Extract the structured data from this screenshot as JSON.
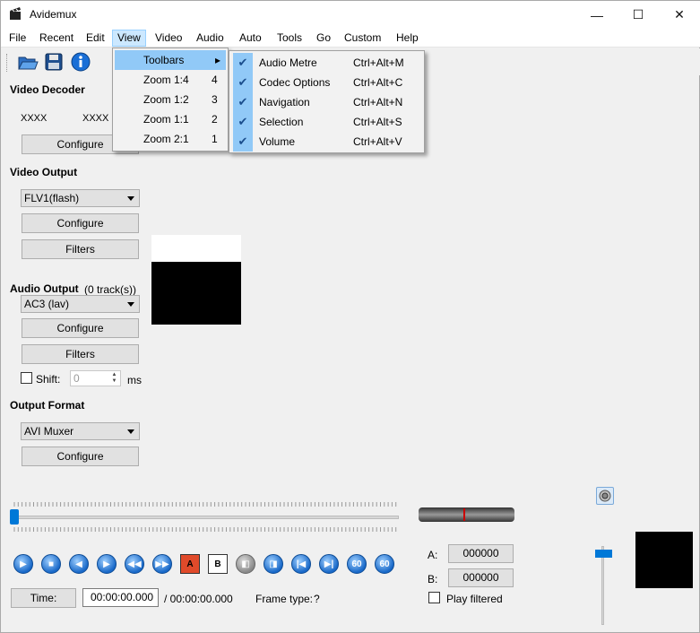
{
  "window": {
    "title": "Avidemux",
    "minimize_glyph": "—",
    "maximize_glyph": "☐",
    "close_glyph": "✕"
  },
  "menubar": {
    "items": [
      "File",
      "Recent",
      "Edit",
      "View",
      "Video",
      "Audio",
      "Auto",
      "Tools",
      "Go",
      "Custom",
      "Help"
    ],
    "open_menu": "View"
  },
  "toolbar": {
    "icons": [
      "open-file-icon",
      "save-file-icon",
      "info-icon"
    ]
  },
  "view_menu": {
    "items": [
      {
        "label": "Toolbars",
        "key": "▸",
        "highlighted": true
      },
      {
        "label": "Zoom 1:4",
        "key": "4"
      },
      {
        "label": "Zoom 1:2",
        "key": "3"
      },
      {
        "label": "Zoom 1:1",
        "key": "2"
      },
      {
        "label": "Zoom 2:1",
        "key": "1"
      }
    ]
  },
  "toolbars_submenu": {
    "items": [
      {
        "label": "Audio Metre",
        "shortcut": "Ctrl+Alt+M",
        "checked": true
      },
      {
        "label": "Codec Options",
        "shortcut": "Ctrl+Alt+C",
        "checked": true
      },
      {
        "label": "Navigation",
        "shortcut": "Ctrl+Alt+N",
        "checked": true
      },
      {
        "label": "Selection",
        "shortcut": "Ctrl+Alt+S",
        "checked": true
      },
      {
        "label": "Volume",
        "shortcut": "Ctrl+Alt+V",
        "checked": true
      }
    ],
    "check_glyph": "✔"
  },
  "video_decoder": {
    "title": "Video Decoder",
    "value_left": "XXXX",
    "value_right": "XXXX",
    "configure_label": "Configure"
  },
  "video_output": {
    "title": "Video Output",
    "codec": "FLV1(flash)",
    "configure_label": "Configure",
    "filters_label": "Filters"
  },
  "audio_output": {
    "title": "Audio Output",
    "tracks": "(0 track(s))",
    "codec": "AC3 (lav)",
    "configure_label": "Configure",
    "filters_label": "Filters",
    "shift_label": "Shift:",
    "shift_value": "0",
    "shift_unit": "ms"
  },
  "output_format": {
    "title": "Output Format",
    "muxer": "AVI Muxer",
    "configure_label": "Configure"
  },
  "navigation": {
    "position_fraction": 0.0
  },
  "selection": {
    "a_label": "A:",
    "a_value": "000000",
    "b_label": "B:",
    "b_value": "000000",
    "play_filtered_label": "Play filtered"
  },
  "status": {
    "time_button_label": "Time:",
    "current_time": "00:00:00.000",
    "total_time": "/ 00:00:00.000",
    "frame_type_label": "Frame type:",
    "frame_type_value": "?"
  },
  "controls": {
    "buttons": [
      {
        "name": "play-icon",
        "glyph": "▶"
      },
      {
        "name": "stop-icon",
        "glyph": "■"
      },
      {
        "name": "previous-frame-icon",
        "glyph": "◀"
      },
      {
        "name": "next-frame-icon",
        "glyph": "▶"
      },
      {
        "name": "previous-keyframe-icon",
        "glyph": "◀◀"
      },
      {
        "name": "next-keyframe-icon",
        "glyph": "▶▶"
      },
      {
        "name": "set-marker-a-icon",
        "glyph": "A"
      },
      {
        "name": "set-marker-b-icon",
        "glyph": "B"
      },
      {
        "name": "previous-black-frame-icon",
        "glyph": "◧"
      },
      {
        "name": "next-black-frame-icon",
        "glyph": "◨"
      },
      {
        "name": "first-frame-icon",
        "glyph": "|◀"
      },
      {
        "name": "last-frame-icon",
        "glyph": "▶|"
      },
      {
        "name": "back-60s-icon",
        "glyph": "60"
      },
      {
        "name": "forward-60s-icon",
        "glyph": "60"
      }
    ]
  },
  "colors": {
    "accent": "#0078d7",
    "menu_highlight": "#91c9f7"
  }
}
